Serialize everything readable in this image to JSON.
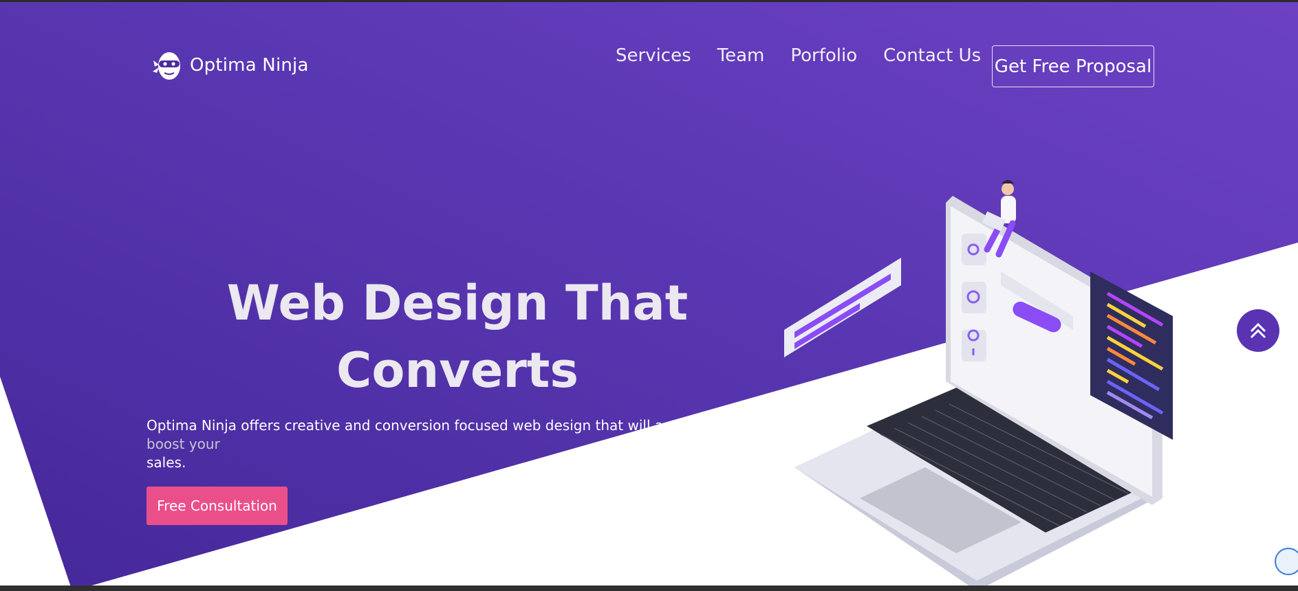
{
  "brand": {
    "name": "Optima Ninja",
    "logo_icon": "ninja-head-icon"
  },
  "nav": {
    "links": [
      "Services",
      "Team",
      "Porfolio",
      "Contact Us"
    ],
    "cta_label": "Get Free Proposal"
  },
  "hero": {
    "title_line1": "Web Design That",
    "title_line2": "Converts",
    "description_main": "Optima Ninja offers creative and conversion focused web design that will actually ",
    "description_faded": "boost your",
    "description_line2": "sales.",
    "cta_label": "Free Consultation",
    "illustration_icon": "laptop-web-design-illustration"
  },
  "widgets": {
    "scroll_top_icon": "double-chevron-up-icon",
    "chat_badge_icon": "chat-widget-icon"
  },
  "colors": {
    "hero_gradient_start": "#4a2a9e",
    "hero_gradient_end": "#6a3fc0",
    "cta_pink": "#ea4f8a",
    "accent_purple": "#7c4dff"
  }
}
